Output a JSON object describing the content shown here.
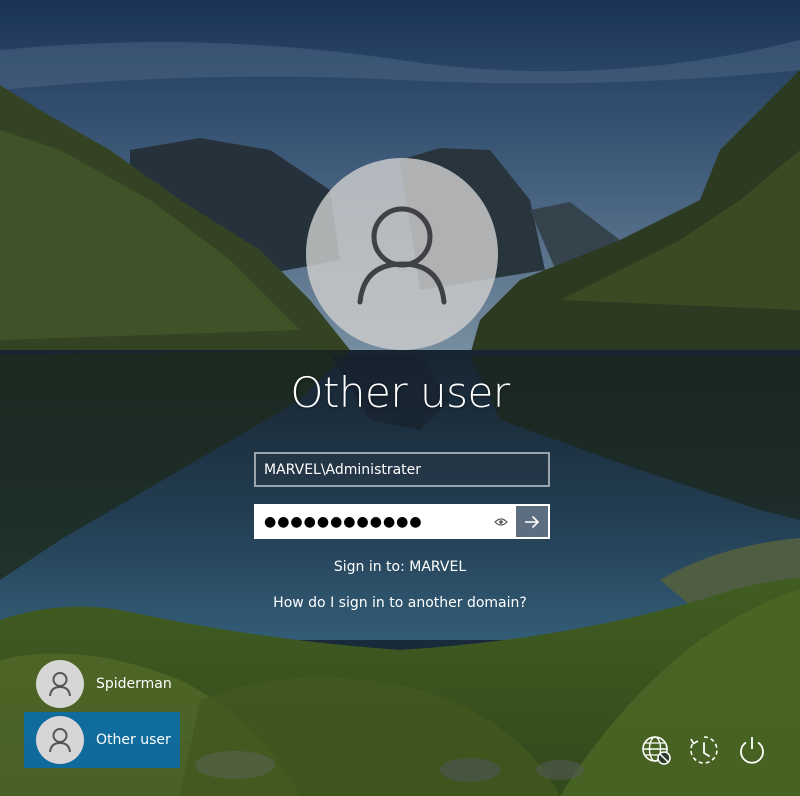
{
  "login": {
    "display_name": "Other user",
    "username_value": "MARVEL\\Administrater",
    "password_value": "●●●●●●●●●●●●",
    "sign_in_to": "Sign in to: MARVEL",
    "help_link": "How do I sign in to another domain?"
  },
  "user_list": [
    {
      "label": "Spiderman",
      "selected": false
    },
    {
      "label": "Other user",
      "selected": true
    }
  ],
  "system_icons": [
    "network-icon",
    "accessibility-icon",
    "power-icon"
  ],
  "colors": {
    "selected_tile": "#0a6ebe",
    "submit_button": "#5d6e80"
  }
}
